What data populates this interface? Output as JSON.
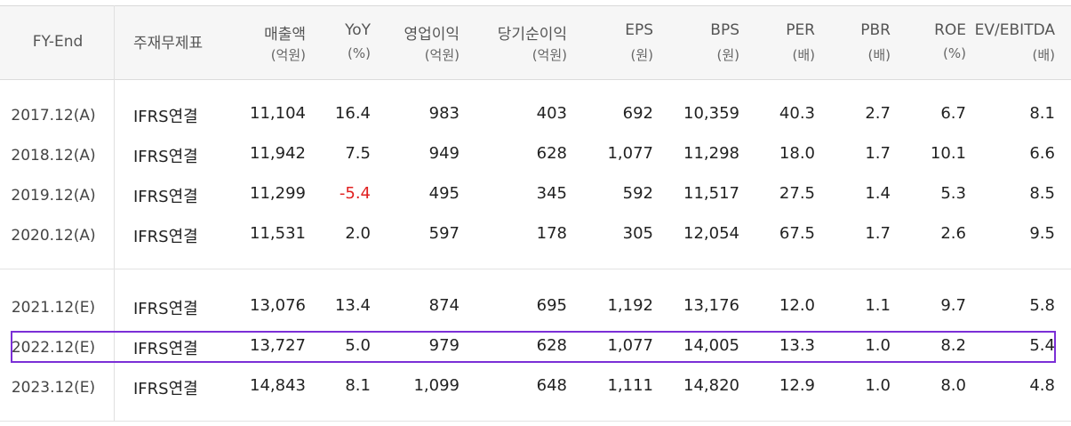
{
  "header": {
    "fy_end": "FY-End",
    "basis": "주재무제표",
    "cols": [
      {
        "l1": "매출액",
        "l2": "(억원)"
      },
      {
        "l1": "YoY",
        "l2": "(%)"
      },
      {
        "l1": "영업이익",
        "l2": "(억원)"
      },
      {
        "l1": "당기순이익",
        "l2": "(억원)"
      },
      {
        "l1": "EPS",
        "l2": "(원)"
      },
      {
        "l1": "BPS",
        "l2": "(원)"
      },
      {
        "l1": "PER",
        "l2": "(배)"
      },
      {
        "l1": "PBR",
        "l2": "(배)"
      },
      {
        "l1": "ROE",
        "l2": "(%)"
      },
      {
        "l1": "EV/EBITDA",
        "l2": "(배)"
      }
    ]
  },
  "rows": [
    {
      "fy": "2017.12(A)",
      "basis": "IFRS연결",
      "v": [
        "11,104",
        "16.4",
        "983",
        "403",
        "692",
        "10,359",
        "40.3",
        "2.7",
        "6.7",
        "8.1"
      ]
    },
    {
      "fy": "2018.12(A)",
      "basis": "IFRS연결",
      "v": [
        "11,942",
        "7.5",
        "949",
        "628",
        "1,077",
        "11,298",
        "18.0",
        "1.7",
        "10.1",
        "6.6"
      ]
    },
    {
      "fy": "2019.12(A)",
      "basis": "IFRS연결",
      "v": [
        "11,299",
        "-5.4",
        "495",
        "345",
        "592",
        "11,517",
        "27.5",
        "1.4",
        "5.3",
        "8.5"
      ]
    },
    {
      "fy": "2020.12(A)",
      "basis": "IFRS연결",
      "v": [
        "11,531",
        "2.0",
        "597",
        "178",
        "305",
        "12,054",
        "67.5",
        "1.7",
        "2.6",
        "9.5"
      ]
    },
    {
      "fy": "2021.12(E)",
      "basis": "IFRS연결",
      "v": [
        "13,076",
        "13.4",
        "874",
        "695",
        "1,192",
        "13,176",
        "12.0",
        "1.1",
        "9.7",
        "5.8"
      ]
    },
    {
      "fy": "2022.12(E)",
      "basis": "IFRS연결",
      "v": [
        "13,727",
        "5.0",
        "979",
        "628",
        "1,077",
        "14,005",
        "13.3",
        "1.0",
        "8.2",
        "5.4"
      ]
    },
    {
      "fy": "2023.12(E)",
      "basis": "IFRS연결",
      "v": [
        "14,843",
        "8.1",
        "1,099",
        "648",
        "1,111",
        "14,820",
        "12.9",
        "1.0",
        "8.0",
        "4.8"
      ]
    }
  ],
  "colors": {
    "negative": "#e02020",
    "highlight": "#7b2fd6"
  }
}
